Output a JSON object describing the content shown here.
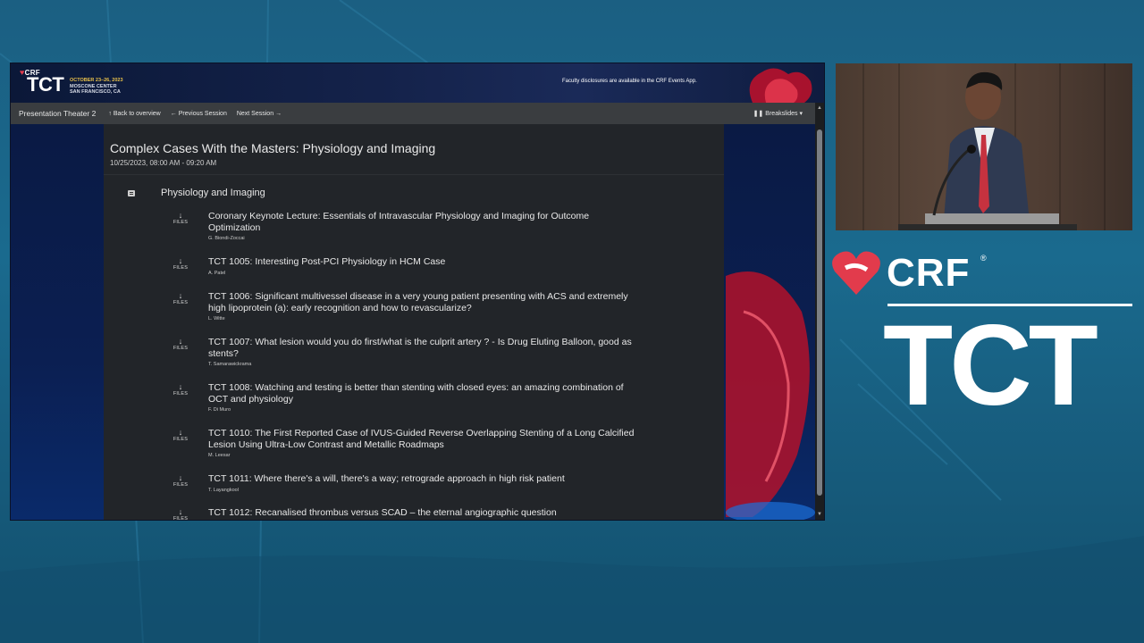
{
  "colors": {
    "accent_red": "#e23b4c",
    "banner_gold": "#e8c04a",
    "panel_bg": "#222529",
    "nav_bg": "#3a3d40"
  },
  "banner": {
    "crf_label": "CRF",
    "tct_label": "TCT",
    "event_dates": "OCTOBER 23–26, 2023",
    "venue": "MOSCONE CENTER",
    "city": "SAN FRANCISCO, CA",
    "disclosure": "Faculty disclosures are available in the CRF Events App."
  },
  "nav": {
    "theater": "Presentation Theater 2",
    "back": "Back to overview",
    "previous": "Previous Session",
    "next": "Next Session",
    "breakslides": "Breakslides"
  },
  "session": {
    "title": "Complex Cases With the Masters: Physiology and Imaging",
    "date": "10/25/2023, 08:00 AM - 09:20 AM",
    "section_label": "Physiology and Imaging",
    "files_label": "FILES",
    "items": [
      {
        "title": "Coronary Keynote Lecture: Essentials of Intravascular Physiology and Imaging for Outcome Optimization",
        "author": "G. Biondi-Zoccai"
      },
      {
        "title": "TCT 1005: Interesting Post-PCI Physiology in HCM Case",
        "author": "A. Patel"
      },
      {
        "title": "TCT 1006: Significant multivessel disease in a very young patient presenting with ACS and extremely high lipoprotein (a): early recognition and how to revascularize?",
        "author": "L. Witte"
      },
      {
        "title": "TCT 1007: What lesion would you do first/what is the culprit artery ? - Is Drug Eluting Balloon, good as stents?",
        "author": "T. Samarawickrama"
      },
      {
        "title": "TCT 1008: Watching and testing is better than stenting with closed eyes: an amazing combination of OCT and physiology",
        "author": "F. Di Muro"
      },
      {
        "title": "TCT 1010: The First Reported Case of IVUS-Guided Reverse Overlapping Stenting of a Long Calcified Lesion Using Ultra-Low Contrast and Metallic Roadmaps",
        "author": "M. Leesar"
      },
      {
        "title": "TCT 1011: Where there's a will, there's a way; retrograde approach in high risk patient",
        "author": "T. Layangkool"
      },
      {
        "title": "TCT 1012: Recanalised thrombus versus SCAD – the eternal angiographic question",
        "author": ""
      }
    ]
  },
  "branding": {
    "crf": "CRF",
    "registered": "®",
    "tct": "TCT"
  }
}
